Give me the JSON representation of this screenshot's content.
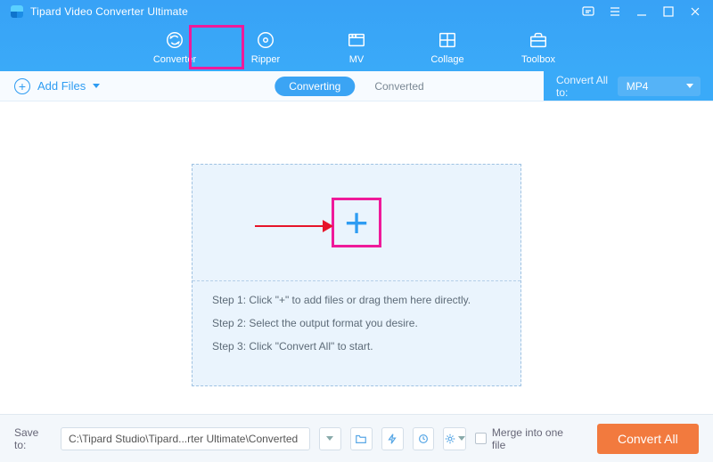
{
  "app": {
    "title": "Tipard Video Converter Ultimate"
  },
  "tabs": {
    "converter": "Converter",
    "ripper": "Ripper",
    "mv": "MV",
    "collage": "Collage",
    "toolbox": "Toolbox"
  },
  "toolbar": {
    "add_files": "Add Files",
    "seg_converting": "Converting",
    "seg_converted": "Converted",
    "convert_all_label": "Convert All to:",
    "format_selected": "MP4"
  },
  "dropzone": {
    "step1": "Step 1: Click \"+\" to add files or drag them here directly.",
    "step2": "Step 2: Select the output format you desire.",
    "step3": "Step 3: Click \"Convert All\" to start."
  },
  "footer": {
    "save_to_label": "Save to:",
    "save_path": "C:\\Tipard Studio\\Tipard...rter Ultimate\\Converted",
    "merge_label": "Merge into one file",
    "convert_button": "Convert All"
  }
}
